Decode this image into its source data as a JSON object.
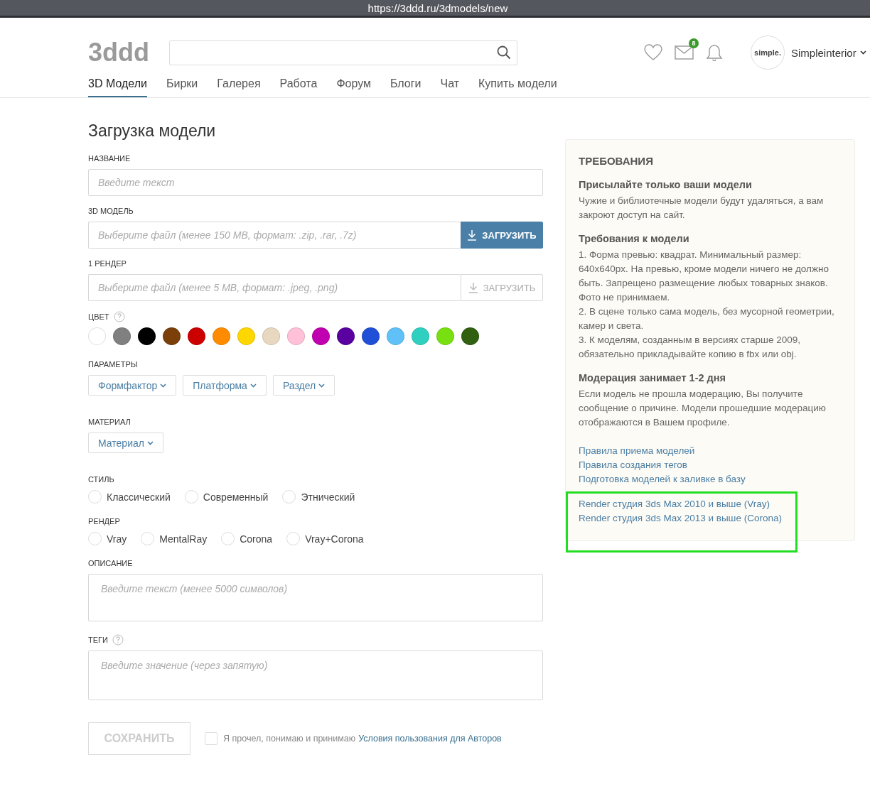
{
  "browser": {
    "url": "https://3ddd.ru/3dmodels/new"
  },
  "header": {
    "logo": "3ddd",
    "mail_badge": "8",
    "avatar_text": "simple.",
    "username": "Simpleinterior"
  },
  "nav": [
    {
      "label": "3D Модели",
      "selected": true
    },
    {
      "label": "Бирки",
      "selected": false
    },
    {
      "label": "Галерея",
      "selected": false
    },
    {
      "label": "Работа",
      "selected": false
    },
    {
      "label": "Форум",
      "selected": false
    },
    {
      "label": "Блоги",
      "selected": false
    },
    {
      "label": "Чат",
      "selected": false
    },
    {
      "label": "Купить модели",
      "selected": false
    }
  ],
  "form": {
    "title": "Загрузка модели",
    "name": {
      "label": "НАЗВАНИЕ",
      "placeholder": "Введите текст"
    },
    "model_file": {
      "label": "3D МОДЕЛЬ",
      "placeholder": "Выберите файл (менее 150 MB, формат: .zip, .rar, .7z)",
      "button": "ЗАГРУЗИТЬ",
      "disabled": false
    },
    "render_file": {
      "label": "1 РЕНДЕР",
      "placeholder": "Выберите файл (менее 5 MB, формат: .jpeg, .png)",
      "button": "ЗАГРУЗИТЬ",
      "disabled": true
    },
    "color": {
      "label": "ЦВЕТ",
      "swatches": [
        {
          "color": "#ffffff"
        },
        {
          "color": "#808080"
        },
        {
          "color": "#000000"
        },
        {
          "color": "#7b3f0a"
        },
        {
          "color": "#cc0000"
        },
        {
          "color": "#ff8c00"
        },
        {
          "color": "#ffd700"
        },
        {
          "color": "#e8d8c0"
        },
        {
          "color": "#ffc0d8"
        },
        {
          "color": "#c000b0"
        },
        {
          "color": "#5a00a0"
        },
        {
          "color": "#2050d8"
        },
        {
          "color": "#60c0f8"
        },
        {
          "color": "#30d0c0"
        },
        {
          "color": "#78e010"
        },
        {
          "color": "#306010"
        }
      ]
    },
    "parameters": {
      "label": "ПАРАМЕТРЫ",
      "dropdowns": [
        "Формфактор",
        "Платформа",
        "Раздел"
      ]
    },
    "material": {
      "label": "МАТЕРИАЛ",
      "dropdowns": [
        "Материал"
      ]
    },
    "style": {
      "label": "СТИЛЬ",
      "options": [
        {
          "label": "Классический",
          "selected": false
        },
        {
          "label": "Современный",
          "selected": false
        },
        {
          "label": "Этнический",
          "selected": false
        }
      ]
    },
    "render": {
      "label": "РЕНДЕР",
      "options": [
        {
          "label": "Vray",
          "selected": false
        },
        {
          "label": "MentalRay",
          "selected": false
        },
        {
          "label": "Corona",
          "selected": false
        },
        {
          "label": "Vray+Corona",
          "selected": false
        }
      ]
    },
    "description": {
      "label": "ОПИСАНИЕ",
      "placeholder": "Введите текст (менее 5000 символов)"
    },
    "tags": {
      "label": "ТЕГИ",
      "placeholder": "Введите значение (через запятую)"
    },
    "save": {
      "label": "СОХРАНИТЬ",
      "disabled": true
    },
    "agree": {
      "checked": false,
      "text": "Я прочел, понимаю и принимаю",
      "link": "Условия пользования для Авторов"
    }
  },
  "requirements": {
    "title": "ТРЕБОВАНИЯ",
    "sections": [
      {
        "heading": "Присылайте только ваши модели",
        "lines": [
          "Чужие и библиотечные модели будут удаляться, а вам закроют доступ на сайт."
        ]
      },
      {
        "heading": "Требования к модели",
        "lines": [
          "1. Форма превью: квадрат. Минимальный размер: 640x640px. На превью, кроме модели ничего не должно быть. Запрещено размещение любых товарных знаков. Фото не принимаем.",
          "2. В сцене только сама модель, без мусорной геометрии, камер и света.",
          "3. К моделям, созданным в версиях старше 2009, обязательно прикладывайте копию в fbx или obj."
        ]
      },
      {
        "heading": "Модерация занимает 1-2 дня",
        "lines": [
          "Если модель не прошла модерацию, Вы получите сообщение о причине. Модели прошедшие модерацию отображаются в Вашем профиле."
        ]
      }
    ],
    "links": [
      "Правила приема моделей",
      "Правила создания тегов",
      "Подготовка моделей к заливке в базу"
    ],
    "studio_links": [
      "Render студия 3ds Max 2010 и выше (Vray)",
      "Render студия 3ds Max 2013 и выше (Corona)"
    ]
  }
}
